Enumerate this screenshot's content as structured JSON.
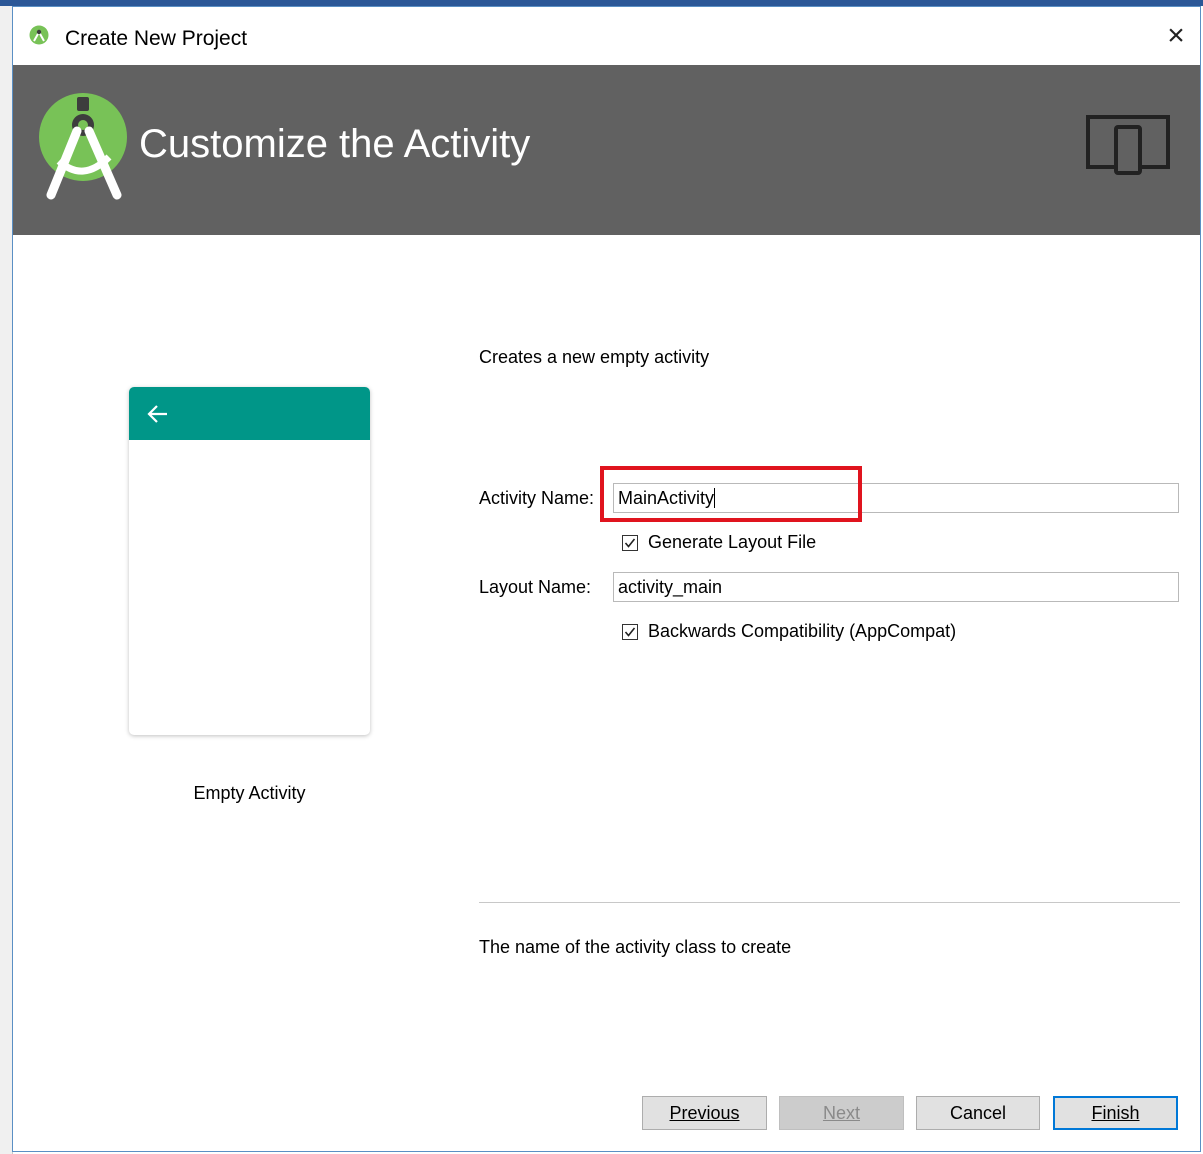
{
  "window": {
    "title": "Create New Project",
    "close_glyph": "×"
  },
  "banner": {
    "title": "Customize the Activity",
    "logo_icon": "android-studio-logo-icon",
    "device_icon": "device-form-factor-icon"
  },
  "preview": {
    "caption": "Empty Activity",
    "bar_color": "#009688",
    "back_icon": "back-arrow-icon"
  },
  "form": {
    "description": "Creates a new empty activity",
    "activity_name_label": "Activity Name:",
    "activity_name_value": "MainActivity",
    "generate_layout_label": "Generate Layout File",
    "generate_layout_checked": true,
    "layout_name_label": "Layout Name:",
    "layout_name_value": "activity_main",
    "backwards_compat_label": "Backwards Compatibility (AppCompat)",
    "backwards_compat_checked": true,
    "help_text": "The name of the activity class to create"
  },
  "buttons": {
    "previous": "Previous",
    "next": "Next",
    "cancel": "Cancel",
    "finish": "Finish"
  },
  "colors": {
    "banner_bg": "#616161",
    "highlight_border": "#e0141e",
    "accent": "#0078d7"
  }
}
